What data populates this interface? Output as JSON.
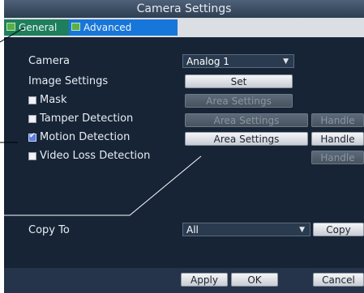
{
  "window": {
    "title": "Camera Settings"
  },
  "tabs": [
    {
      "label": "General",
      "icon": "tab-icon"
    },
    {
      "label": "Advanced",
      "icon": "tab-icon"
    }
  ],
  "settings": {
    "camera_label": "Camera",
    "camera_value": "Analog 1",
    "image_settings_label": "Image Settings",
    "set_button": "Set",
    "rows": [
      {
        "label": "Mask",
        "checked": false,
        "area_button": "Area Settings"
      },
      {
        "label": "Tamper Detection",
        "checked": false,
        "area_button": "Area Settings",
        "handle_button": "Handle"
      },
      {
        "label": "Motion Detection",
        "checked": true,
        "area_button": "Area Settings",
        "handle_button": "Handle"
      },
      {
        "label": "Video Loss Detection",
        "checked": false,
        "handle_button": "Handle"
      }
    ]
  },
  "copy": {
    "label": "Copy To",
    "value": "All",
    "button": "Copy"
  },
  "footer": {
    "apply": "Apply",
    "ok": "OK",
    "cancel": "Cancel"
  },
  "colors": {
    "tab_active": "#1776d9",
    "tab_inactive": "#1d7f5c",
    "background": "#162436",
    "checked": "#5b7fe0"
  }
}
